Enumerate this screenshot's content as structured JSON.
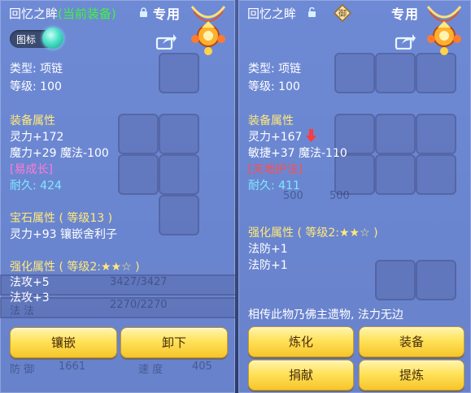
{
  "left": {
    "title": "回忆之眸",
    "title_status": "(当前装备)",
    "exclusive": "专用",
    "toggle_label": "图标",
    "type_line": "类型: 项链",
    "level_line": "等级: 100",
    "equip_heading": "装备属性",
    "attr1": "灵力+172",
    "attr2": "魔力+29 魔法-100",
    "special": "[易成长]",
    "durability": "耐久: 424",
    "gem_heading": "宝石属性 ( 等级13 )",
    "gem_attr": "灵力+93 镶嵌舍利子",
    "enhance_heading": "强化属性 ( 等级2:★★☆ )",
    "enh1": "法攻+5",
    "enh2": "法攻+3",
    "buttons": [
      "镶嵌",
      "卸下"
    ],
    "bg_texts": [
      "3427/3427",
      "2270/2270",
      "法 法",
      "防 御",
      "1661",
      "速 度",
      "405"
    ]
  },
  "right": {
    "title": "回忆之眸",
    "badge": "御",
    "exclusive": "专用",
    "type_line": "类型: 项链",
    "level_line": "等级: 100",
    "equip_heading": "装备属性",
    "attr1": "灵力+167",
    "attr2": "敏捷+37 魔法-110",
    "special": "[天地护法]",
    "durability": "耐久: 411",
    "enhance_heading": "强化属性 ( 等级2:★★☆ )",
    "enh1": "法防+1",
    "enh2": "法防+1",
    "lore": "相传此物乃佛主遗物, 法力无边",
    "buttons": [
      "炼化",
      "装备",
      "捐献",
      "提炼"
    ],
    "bg_texts": [
      "500",
      "500"
    ]
  }
}
